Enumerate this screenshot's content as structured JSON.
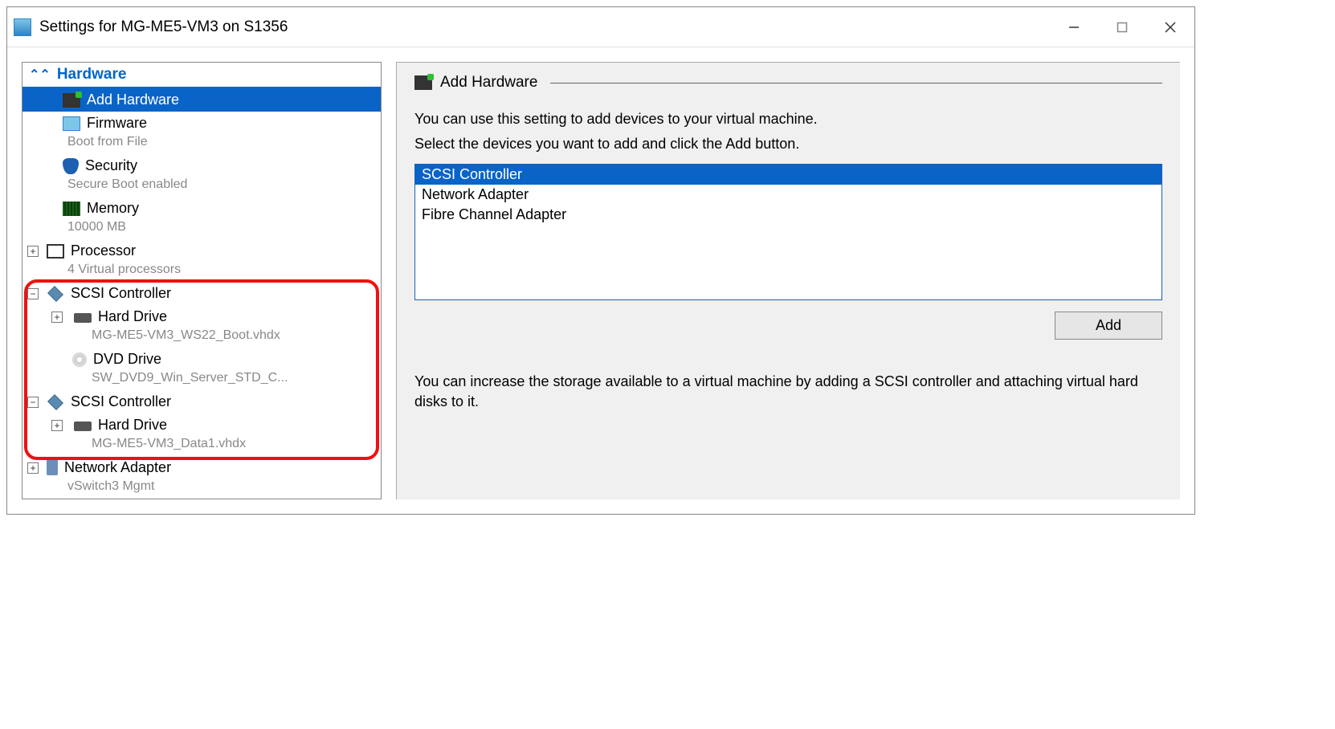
{
  "window": {
    "title": "Settings for MG-ME5-VM3 on S1356"
  },
  "tree": {
    "header": "Hardware",
    "add_hardware": "Add Hardware",
    "firmware": {
      "label": "Firmware",
      "sub": "Boot from File"
    },
    "security": {
      "label": "Security",
      "sub": "Secure Boot enabled"
    },
    "memory": {
      "label": "Memory",
      "sub": "10000 MB"
    },
    "processor": {
      "label": "Processor",
      "sub": "4 Virtual processors"
    },
    "scsi1": {
      "label": "SCSI Controller",
      "hd": {
        "label": "Hard Drive",
        "sub": "MG-ME5-VM3_WS22_Boot.vhdx"
      },
      "dvd": {
        "label": "DVD Drive",
        "sub": "SW_DVD9_Win_Server_STD_C..."
      }
    },
    "scsi2": {
      "label": "SCSI Controller",
      "hd": {
        "label": "Hard Drive",
        "sub": "MG-ME5-VM3_Data1.vhdx"
      }
    },
    "net": {
      "label": "Network Adapter",
      "sub": "vSwitch3 Mgmt"
    }
  },
  "right": {
    "title": "Add Hardware",
    "desc1": "You can use this setting to add devices to your virtual machine.",
    "desc2": "Select the devices you want to add and click the Add button.",
    "devices": {
      "scsi": "SCSI Controller",
      "net": "Network Adapter",
      "fc": "Fibre Channel Adapter"
    },
    "add_button": "Add",
    "note": "You can increase the storage available to a virtual machine by adding a SCSI controller and attaching virtual hard disks to it."
  }
}
